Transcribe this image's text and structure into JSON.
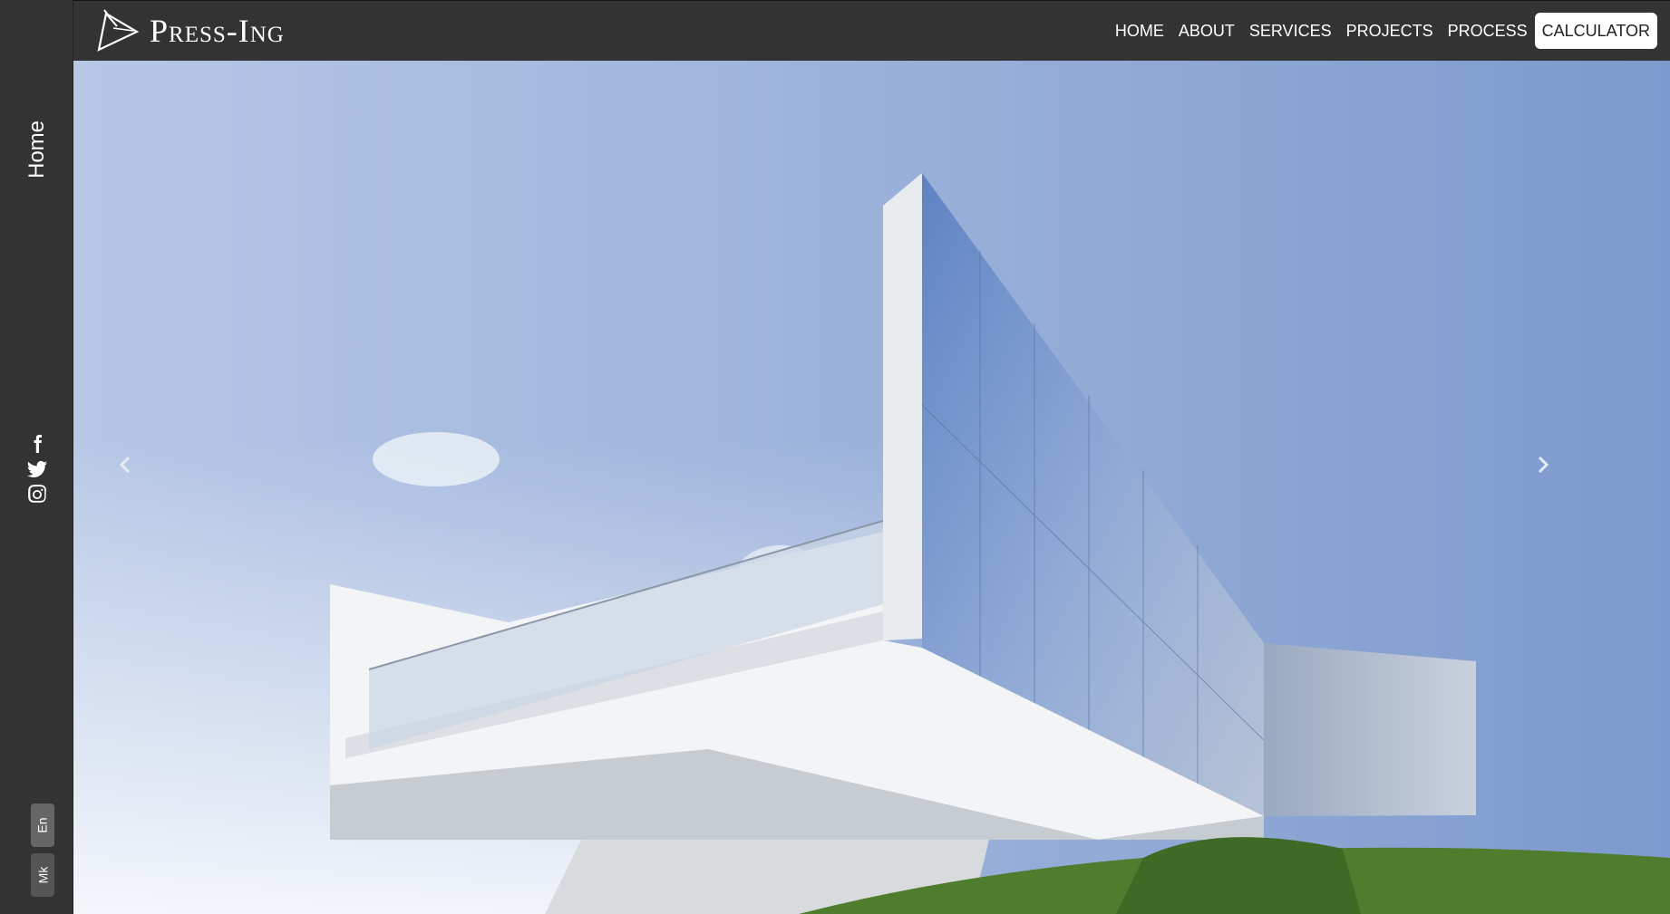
{
  "brand": {
    "name": "Press-Ing",
    "logo_icon": "triangle-logo-icon"
  },
  "nav": {
    "items": [
      {
        "label": "HOME"
      },
      {
        "label": "ABOUT"
      },
      {
        "label": "SERVICES"
      },
      {
        "label": "PROJECTS"
      },
      {
        "label": "PROCESS"
      }
    ],
    "calculator_label": "CALCULATOR"
  },
  "sidebar": {
    "page_label": "Home",
    "social": [
      {
        "icon": "facebook-icon"
      },
      {
        "icon": "twitter-icon"
      },
      {
        "icon": "instagram-icon"
      }
    ],
    "languages": [
      {
        "label": "En",
        "active": true
      },
      {
        "label": "Mk",
        "active": false
      }
    ]
  },
  "hero": {
    "image": "modern mirrored-glass building with cantilevered balcony under blue sky",
    "prev_icon": "chevron-left-icon",
    "next_icon": "chevron-right-icon"
  },
  "colors": {
    "chrome": "#333333",
    "sky_top": "#a9bedf",
    "calculator_bg": "#ffffff"
  }
}
